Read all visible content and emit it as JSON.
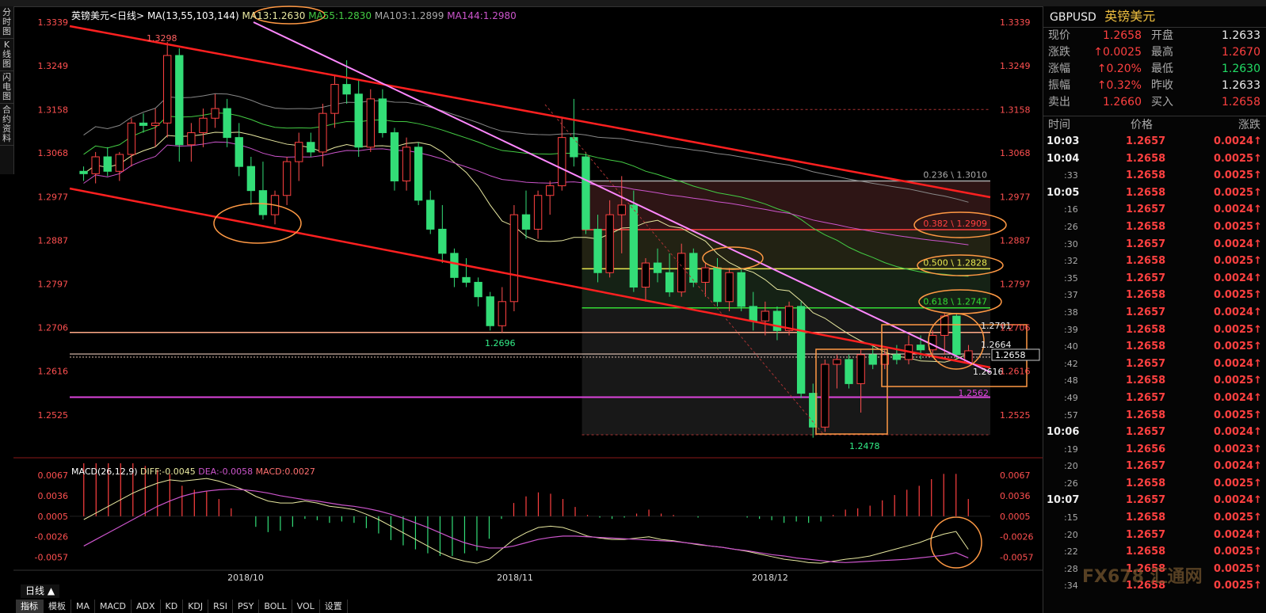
{
  "window": {
    "title_symbol": "GBPUSD",
    "title_name": "英镑美元"
  },
  "left_tabs": [
    "分时图",
    "K线图",
    "闪电图",
    "合约资料"
  ],
  "legend": {
    "name": "英镑美元<日线>",
    "ma_params": "MA(13,55,103,144)",
    "ma13": "MA13:1.2630",
    "ma55": "MA55:1.2830",
    "ma103": "MA103:1.2899",
    "ma144": "MA144:1.2980"
  },
  "macd_legend": {
    "params": "MACD(26,12,9)",
    "diff": "DIFF:-0.0045",
    "dea": "DEA:-0.0058",
    "macd": "MACD:0.0027"
  },
  "quote": {
    "rows": [
      {
        "l1": "现价",
        "v1": "1.2658",
        "c1": "red",
        "l2": "开盘",
        "v2": "1.2633",
        "c2": "white"
      },
      {
        "l1": "涨跌",
        "v1": "↑0.0025",
        "c1": "red",
        "l2": "最高",
        "v2": "1.2670",
        "c2": "red"
      },
      {
        "l1": "涨幅",
        "v1": "↑0.20%",
        "c1": "red",
        "l2": "最低",
        "v2": "1.2630",
        "c2": "green"
      },
      {
        "l1": "振幅",
        "v1": "↑0.32%",
        "c1": "red",
        "l2": "昨收",
        "v2": "1.2633",
        "c2": "white"
      },
      {
        "l1": "卖出",
        "v1": "1.2660",
        "c1": "red",
        "l2": "买入",
        "v2": "1.2658",
        "c2": "red"
      }
    ]
  },
  "ticks": {
    "headers": [
      "时间",
      "价格",
      "涨跌"
    ],
    "rows": [
      [
        "10:03",
        "1.2657",
        "0.0024↑"
      ],
      [
        "10:04",
        "1.2658",
        "0.0025↑"
      ],
      [
        ":33",
        "1.2658",
        "0.0025↑"
      ],
      [
        "10:05",
        "1.2658",
        "0.0025↑"
      ],
      [
        ":16",
        "1.2657",
        "0.0024↑"
      ],
      [
        ":26",
        "1.2658",
        "0.0025↑"
      ],
      [
        ":30",
        "1.2657",
        "0.0024↑"
      ],
      [
        ":32",
        "1.2658",
        "0.0025↑"
      ],
      [
        ":35",
        "1.2657",
        "0.0024↑"
      ],
      [
        ":37",
        "1.2658",
        "0.0025↑"
      ],
      [
        ":38",
        "1.2657",
        "0.0024↑"
      ],
      [
        ":39",
        "1.2658",
        "0.0025↑"
      ],
      [
        ":40",
        "1.2658",
        "0.0025↑"
      ],
      [
        ":42",
        "1.2657",
        "0.0024↑"
      ],
      [
        ":48",
        "1.2658",
        "0.0025↑"
      ],
      [
        ":49",
        "1.2657",
        "0.0024↑"
      ],
      [
        ":57",
        "1.2658",
        "0.0025↑"
      ],
      [
        "10:06",
        "1.2657",
        "0.0024↑"
      ],
      [
        ":19",
        "1.2656",
        "0.0023↑"
      ],
      [
        ":20",
        "1.2657",
        "0.0024↑"
      ],
      [
        ":26",
        "1.2658",
        "0.0025↑"
      ],
      [
        "10:07",
        "1.2657",
        "0.0024↑"
      ],
      [
        ":15",
        "1.2658",
        "0.0025↑"
      ],
      [
        ":20",
        "1.2657",
        "0.0024↑"
      ],
      [
        ":22",
        "1.2658",
        "0.0025↑"
      ],
      [
        ":28",
        "1.2658",
        "0.0025↑"
      ],
      [
        ":34",
        "1.2658",
        "0.0025↑"
      ]
    ]
  },
  "bottom": {
    "period": "日线 ▲",
    "tabs": [
      "指标",
      "模板",
      "MA",
      "MACD",
      "ADX",
      "KD",
      "KDJ",
      "RSI",
      "PSY",
      "BOLL",
      "VOL",
      "设置"
    ]
  },
  "watermark": "FX678 汇通网",
  "colors": {
    "up": "#ff4040",
    "down": "#33dd77",
    "ma13": "#e8e8a0",
    "ma55": "#44cc44",
    "ma103": "#888888",
    "ma144": "#cc55cc"
  },
  "chart_data": {
    "type": "candlestick",
    "price_axis": {
      "ticks": [
        1.3339,
        1.3249,
        1.3158,
        1.3068,
        1.2977,
        1.2887,
        1.2797,
        1.2706,
        1.2616,
        1.2525
      ],
      "range": [
        1.2478,
        1.3339
      ]
    },
    "x_labels": [
      "2018/10",
      "2018/11",
      "2018/12"
    ],
    "last_price": "1.2658",
    "annotations": [
      "1.3298",
      "1.2696",
      "1.2478",
      "1.2562",
      "1.2701",
      "1.2664",
      "1.2616"
    ],
    "fib_levels": [
      {
        "label": "0.236 \\ 1.3010",
        "price": 1.301
      },
      {
        "label": "0.382 \\ 1.2909",
        "price": 1.2909
      },
      {
        "label": "0.500 \\ 1.2828",
        "price": 1.2828
      },
      {
        "label": "0.618 \\ 1.2747",
        "price": 1.2747
      }
    ],
    "candles": [
      [
        1.303,
        1.304,
        1.301,
        1.3025
      ],
      [
        1.3025,
        1.307,
        1.3005,
        1.306
      ],
      [
        1.306,
        1.308,
        1.302,
        1.303
      ],
      [
        1.303,
        1.307,
        1.301,
        1.3065
      ],
      [
        1.3065,
        1.314,
        1.304,
        1.313
      ],
      [
        1.313,
        1.315,
        1.311,
        1.3125
      ],
      [
        1.3125,
        1.316,
        1.308,
        1.313
      ],
      [
        1.313,
        1.3298,
        1.31,
        1.327
      ],
      [
        1.327,
        1.3285,
        1.305,
        1.3085
      ],
      [
        1.3085,
        1.313,
        1.305,
        1.311
      ],
      [
        1.311,
        1.316,
        1.308,
        1.314
      ],
      [
        1.314,
        1.319,
        1.312,
        1.316
      ],
      [
        1.316,
        1.318,
        1.308,
        1.31
      ],
      [
        1.31,
        1.313,
        1.302,
        1.304
      ],
      [
        1.304,
        1.306,
        1.296,
        1.299
      ],
      [
        1.299,
        1.305,
        1.293,
        1.294
      ],
      [
        1.294,
        1.299,
        1.292,
        1.298
      ],
      [
        1.298,
        1.306,
        1.296,
        1.305
      ],
      [
        1.305,
        1.311,
        1.301,
        1.309
      ],
      [
        1.309,
        1.311,
        1.306,
        1.307
      ],
      [
        1.307,
        1.317,
        1.304,
        1.315
      ],
      [
        1.315,
        1.323,
        1.312,
        1.321
      ],
      [
        1.321,
        1.326,
        1.317,
        1.319
      ],
      [
        1.319,
        1.322,
        1.306,
        1.308
      ],
      [
        1.308,
        1.32,
        1.307,
        1.318
      ],
      [
        1.318,
        1.32,
        1.31,
        1.311
      ],
      [
        1.311,
        1.312,
        1.299,
        1.301
      ],
      [
        1.301,
        1.31,
        1.299,
        1.308
      ],
      [
        1.308,
        1.309,
        1.296,
        1.297
      ],
      [
        1.297,
        1.299,
        1.29,
        1.291
      ],
      [
        1.291,
        1.296,
        1.284,
        1.286
      ],
      [
        1.286,
        1.287,
        1.279,
        1.281
      ],
      [
        1.281,
        1.285,
        1.279,
        1.28
      ],
      [
        1.28,
        1.281,
        1.275,
        1.277
      ],
      [
        1.277,
        1.278,
        1.27,
        1.271
      ],
      [
        1.271,
        1.279,
        1.2696,
        1.276
      ],
      [
        1.276,
        1.296,
        1.274,
        1.294
      ],
      [
        1.294,
        1.299,
        1.289,
        1.291
      ],
      [
        1.291,
        1.299,
        1.289,
        1.298
      ],
      [
        1.298,
        1.301,
        1.294,
        1.3
      ],
      [
        1.3,
        1.314,
        1.299,
        1.31
      ],
      [
        1.31,
        1.318,
        1.304,
        1.306
      ],
      [
        1.306,
        1.307,
        1.29,
        1.291
      ],
      [
        1.291,
        1.294,
        1.28,
        1.282
      ],
      [
        1.282,
        1.297,
        1.281,
        1.294
      ],
      [
        1.294,
        1.302,
        1.286,
        1.296
      ],
      [
        1.296,
        1.299,
        1.278,
        1.279
      ],
      [
        1.279,
        1.285,
        1.276,
        1.284
      ],
      [
        1.284,
        1.287,
        1.28,
        1.282
      ],
      [
        1.282,
        1.286,
        1.277,
        1.278
      ],
      [
        1.278,
        1.288,
        1.277,
        1.286
      ],
      [
        1.286,
        1.287,
        1.279,
        1.28
      ],
      [
        1.28,
        1.284,
        1.277,
        1.283
      ],
      [
        1.283,
        1.285,
        1.275,
        1.276
      ],
      [
        1.276,
        1.283,
        1.274,
        1.282
      ],
      [
        1.282,
        1.283,
        1.274,
        1.275
      ],
      [
        1.275,
        1.278,
        1.27,
        1.272
      ],
      [
        1.272,
        1.276,
        1.269,
        1.274
      ],
      [
        1.274,
        1.275,
        1.268,
        1.27
      ],
      [
        1.27,
        1.276,
        1.269,
        1.275
      ],
      [
        1.275,
        1.276,
        1.256,
        1.257
      ],
      [
        1.257,
        1.259,
        1.2478,
        1.25
      ],
      [
        1.25,
        1.264,
        1.249,
        1.263
      ],
      [
        1.263,
        1.265,
        1.258,
        1.264
      ],
      [
        1.264,
        1.265,
        1.258,
        1.259
      ],
      [
        1.259,
        1.266,
        1.253,
        1.265
      ],
      [
        1.265,
        1.267,
        1.262,
        1.263
      ],
      [
        1.263,
        1.266,
        1.262,
        1.265
      ],
      [
        1.265,
        1.267,
        1.263,
        1.264
      ],
      [
        1.264,
        1.269,
        1.263,
        1.267
      ],
      [
        1.267,
        1.269,
        1.264,
        1.266
      ],
      [
        1.266,
        1.2701,
        1.265,
        1.269
      ],
      [
        1.269,
        1.2735,
        1.265,
        1.273
      ],
      [
        1.273,
        1.2735,
        1.264,
        1.265
      ],
      [
        1.2633,
        1.267,
        1.263,
        1.2658
      ]
    ],
    "macd": {
      "ticks": [
        0.0067,
        0.0036,
        0.0005,
        -0.0026,
        -0.0057
      ],
      "diff": [
        0.0,
        0.001,
        0.002,
        0.003,
        0.004,
        0.0048,
        0.0055,
        0.006,
        0.0058,
        0.006,
        0.0062,
        0.0058,
        0.0052,
        0.0045,
        0.0035,
        0.0028,
        0.0025,
        0.0025,
        0.0028,
        0.0025,
        0.002,
        0.0018,
        0.0015,
        0.0008,
        0.0,
        -0.001,
        -0.002,
        -0.003,
        -0.004,
        -0.005,
        -0.0058,
        -0.0063,
        -0.0066,
        -0.006,
        -0.0045,
        -0.003,
        -0.002,
        -0.0012,
        -0.001,
        -0.0012,
        -0.0018,
        -0.0025,
        -0.0028,
        -0.003,
        -0.003,
        -0.0028,
        -0.0026,
        -0.003,
        -0.0032,
        -0.0035,
        -0.0038,
        -0.004,
        -0.0042,
        -0.0045,
        -0.0048,
        -0.0052,
        -0.0056,
        -0.006,
        -0.0062,
        -0.0065,
        -0.0066,
        -0.0063,
        -0.006,
        -0.0058,
        -0.0055,
        -0.005,
        -0.0045,
        -0.004,
        -0.0035,
        -0.0028,
        -0.0022,
        -0.0018,
        -0.0045
      ],
      "dea": [
        -0.004,
        -0.003,
        -0.002,
        -0.001,
        0.0,
        0.001,
        0.002,
        0.0028,
        0.0035,
        0.004,
        0.0043,
        0.0045,
        0.0046,
        0.0045,
        0.0043,
        0.004,
        0.0036,
        0.0033,
        0.003,
        0.0028,
        0.0025,
        0.0022,
        0.002,
        0.0017,
        0.0013,
        0.0008,
        0.0002,
        -0.0005,
        -0.0012,
        -0.002,
        -0.0028,
        -0.0035,
        -0.004,
        -0.0043,
        -0.0043,
        -0.004,
        -0.0035,
        -0.003,
        -0.0027,
        -0.0025,
        -0.0025,
        -0.0026,
        -0.0027,
        -0.0028,
        -0.0029,
        -0.003,
        -0.0031,
        -0.0032,
        -0.0033,
        -0.0035,
        -0.0037,
        -0.004,
        -0.0042,
        -0.0045,
        -0.0047,
        -0.005,
        -0.0053,
        -0.0055,
        -0.0058,
        -0.006,
        -0.0062,
        -0.0064,
        -0.0065,
        -0.0064,
        -0.0063,
        -0.0062,
        -0.0061,
        -0.006,
        -0.0058,
        -0.0056,
        -0.0054,
        -0.005,
        -0.0058
      ]
    }
  }
}
